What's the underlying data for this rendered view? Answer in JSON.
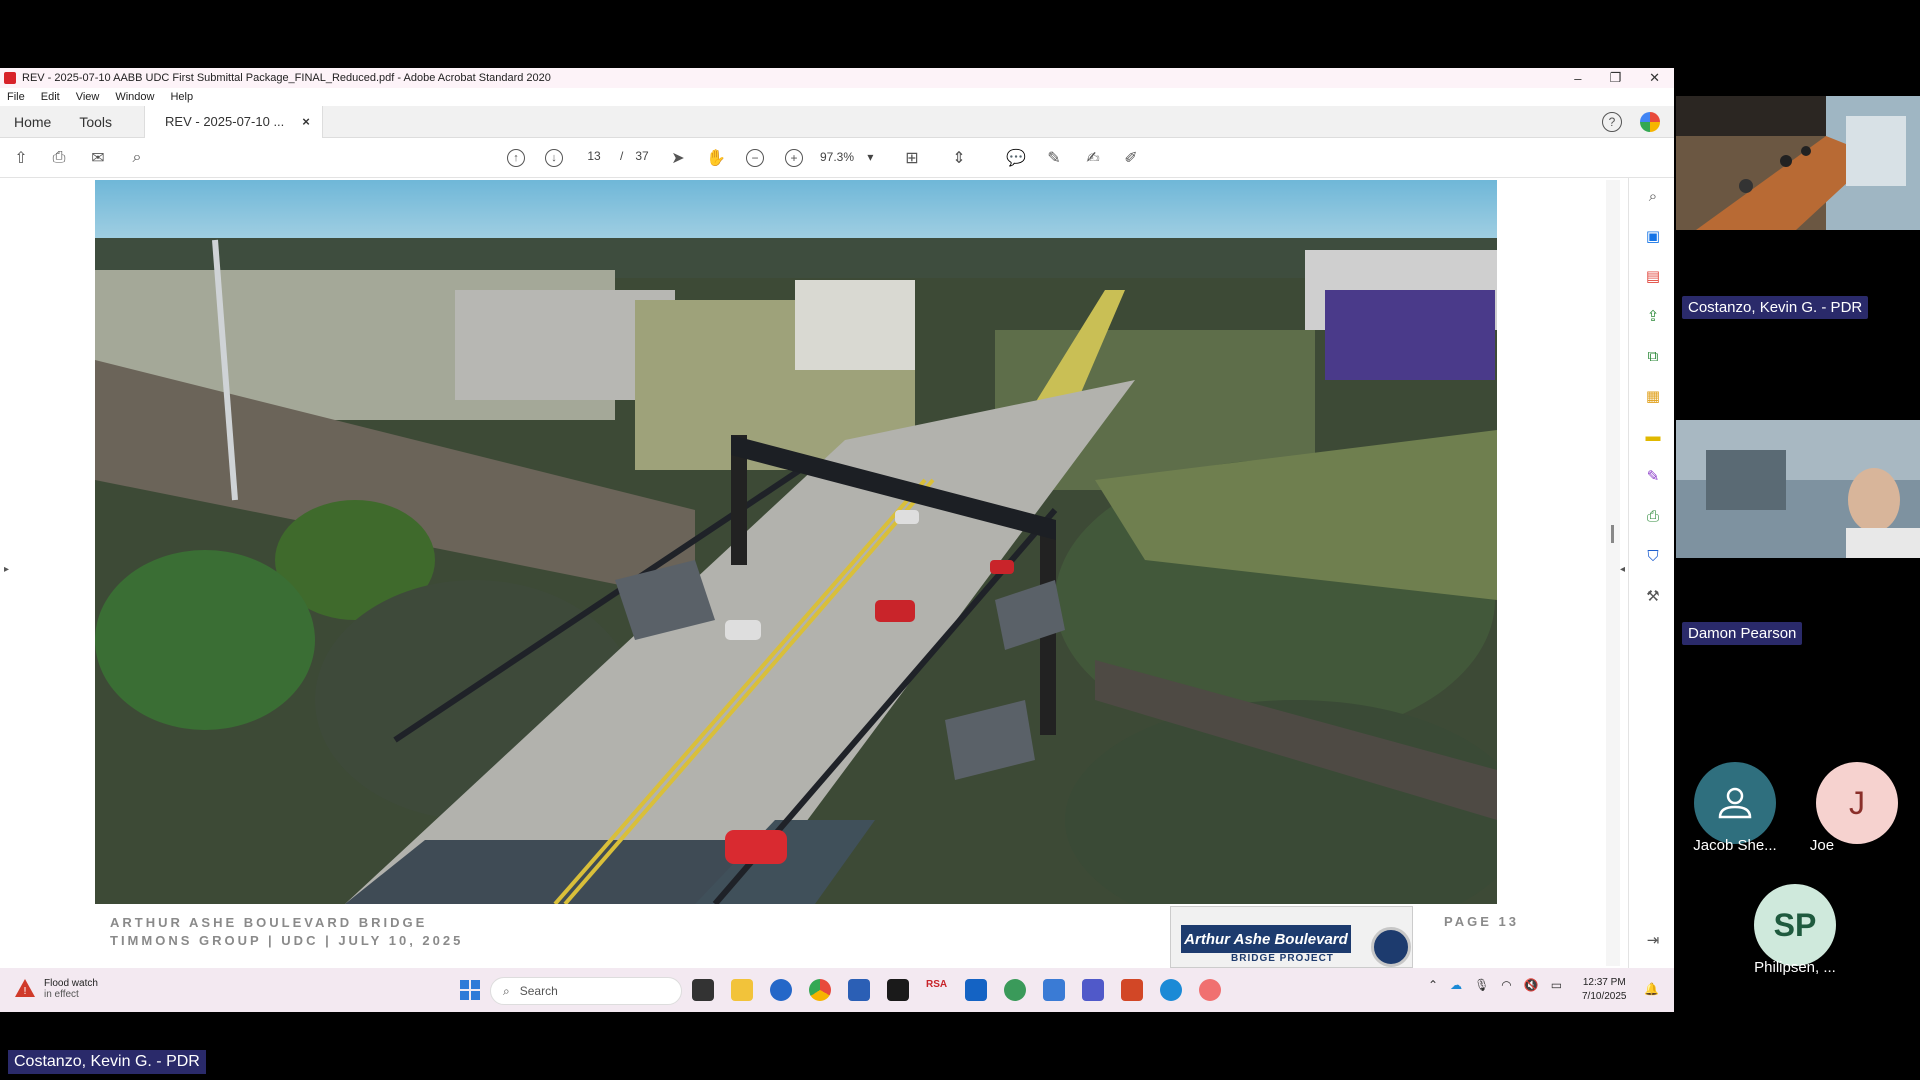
{
  "window": {
    "title": "REV - 2025-07-10 AABB UDC First Submittal Package_FINAL_Reduced.pdf - Adobe Acrobat Standard 2020",
    "controls": [
      "–",
      "❐",
      "✕"
    ]
  },
  "menu": [
    "File",
    "Edit",
    "View",
    "Window",
    "Help"
  ],
  "tabs": {
    "home": "Home",
    "tools": "Tools",
    "doc": "REV - 2025-07-10 ...",
    "doc_close": "×"
  },
  "toolbar": {
    "page_current": "13",
    "page_sep": "/",
    "page_total": "37",
    "zoom": "97.3%"
  },
  "page": {
    "footer_line1": "ARTHUR ASHE BOULEVARD BRIDGE",
    "footer_line2": "TIMMONS GROUP | UDC | JULY 10, 2025",
    "page_label": "PAGE 13",
    "logo_title": "Arthur Ashe Boulevard",
    "logo_sub": "BRIDGE PROJECT"
  },
  "taskbar": {
    "weather_title": "Flood watch",
    "weather_sub": "in effect",
    "search_placeholder": "Search",
    "time": "12:37 PM",
    "date": "7/10/2025"
  },
  "participants": {
    "p1": "Costanzo, Kevin G. - PDR",
    "p2": "Damon Pearson",
    "p3_name": "Jacob She...",
    "p4_initial": "J",
    "p4_name": "Joe",
    "p5_initials": "SP",
    "p5_name": "Philipsen, ...",
    "presenter": "Costanzo, Kevin G. - PDR"
  },
  "colors": {
    "accent": "#1473e6",
    "name_tag": "#2a2a6a",
    "avatar_teal": "#2f6f7e",
    "avatar_pink": "#f6d2cf",
    "avatar_green": "#cfe9dc"
  }
}
